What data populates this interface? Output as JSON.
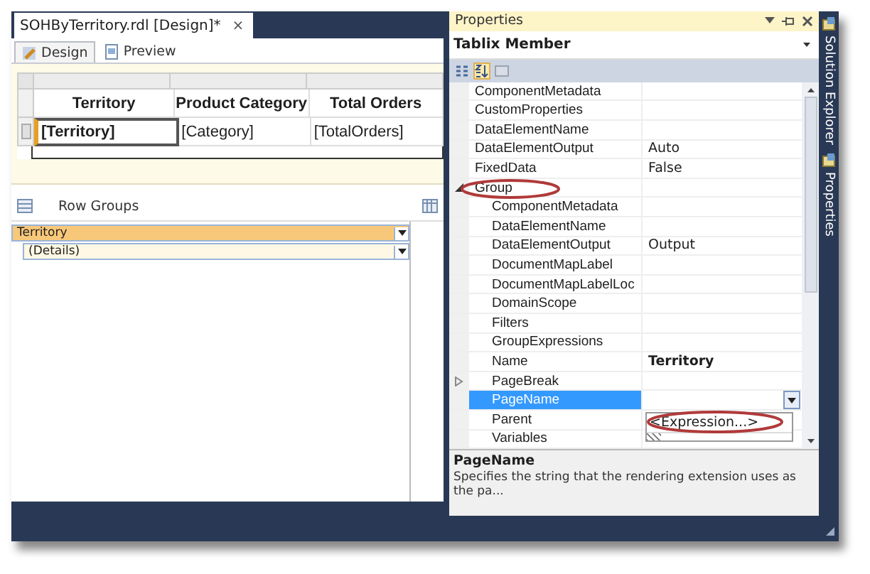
{
  "document_tab": {
    "title": "SOHByTerritory.rdl [Design]*",
    "close": "×"
  },
  "view_tabs": [
    {
      "label": "Design",
      "selected": true
    },
    {
      "label": "Preview",
      "selected": false
    }
  ],
  "tablix": {
    "header": [
      "Territory",
      "Product Category",
      "Total Orders"
    ],
    "row": [
      {
        "text": "[Territory]",
        "selected": true
      },
      {
        "text": "[Category]",
        "selected": false
      },
      {
        "text": "[TotalOrders]",
        "selected": false
      }
    ]
  },
  "row_groups": {
    "title": "Row Groups",
    "items": [
      {
        "label": "Territory",
        "selected": true,
        "children": [
          {
            "label": "(Details)",
            "selected": false
          }
        ]
      }
    ]
  },
  "properties": {
    "title": "Properties",
    "object": "Tablix Member",
    "toolbar": [
      {
        "kind": "categorized",
        "selected": false
      },
      {
        "kind": "alphabetical",
        "selected": true
      },
      {
        "kind": "pages",
        "selected": false
      }
    ],
    "rows": [
      {
        "name": "ComponentMetadata",
        "selected": false
      },
      {
        "name": "CustomProperties",
        "selected": false
      },
      {
        "name": "DataElementName",
        "selected": false
      },
      {
        "name": "DataElementOutput",
        "value": "Auto",
        "modified": false,
        "selected": false
      },
      {
        "name": "FixedData",
        "value": "False",
        "modified": false,
        "selected": false
      },
      {
        "name": "Group",
        "expanded": true,
        "selected": false,
        "children": [
          {
            "name": "ComponentMetadata",
            "selected": false
          },
          {
            "name": "DataElementName",
            "selected": false
          },
          {
            "name": "DataElementOutput",
            "value": "Output",
            "modified": false,
            "selected": false
          },
          {
            "name": "DocumentMapLabel",
            "selected": false
          },
          {
            "name": "DocumentMapLabelLoc",
            "selected": false
          },
          {
            "name": "DomainScope",
            "selected": false
          },
          {
            "name": "Filters",
            "selected": false
          },
          {
            "name": "GroupExpressions",
            "selected": false
          },
          {
            "name": "Name",
            "value": "Territory",
            "modified": true,
            "selected": false
          },
          {
            "name": "PageBreak",
            "expanded": false,
            "selected": false
          },
          {
            "name": "PageName",
            "selected": true,
            "dropdown": true
          },
          {
            "name": "Parent",
            "selected": false
          },
          {
            "name": "Variables",
            "selected": false
          }
        ]
      }
    ],
    "dropdown_list": [
      "<Expression...>"
    ],
    "description": {
      "title": "PageName",
      "text": "Specifies the string that the rendering extension uses as the pa..."
    }
  },
  "side_tabs": [
    {
      "label": "Solution Explorer"
    },
    {
      "label": "Properties"
    }
  ]
}
